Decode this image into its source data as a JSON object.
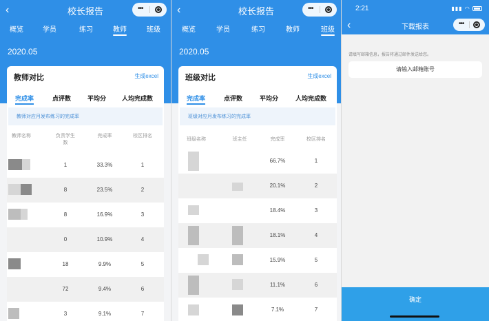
{
  "screens": [
    {
      "nav_title": "校长报告",
      "tabs": [
        "概览",
        "学员",
        "练习",
        "教师",
        "班级"
      ],
      "active_tab": 3,
      "date": "2020.05",
      "card_title": "教师对比",
      "export_label": "生成excel",
      "subtabs": [
        "完成率",
        "点评数",
        "平均分",
        "人均完成数"
      ],
      "note": "教师对应月发布练习的完成率",
      "columns": [
        "教师名称",
        "负责学生数",
        "完成率",
        "校区排名"
      ],
      "rows": [
        {
          "count": "1",
          "rate": "33.3%",
          "rank": "1"
        },
        {
          "count": "8",
          "rate": "23.5%",
          "rank": "2"
        },
        {
          "count": "8",
          "rate": "16.9%",
          "rank": "3"
        },
        {
          "count": "0",
          "rate": "10.9%",
          "rank": "4"
        },
        {
          "count": "18",
          "rate": "9.9%",
          "rank": "5"
        },
        {
          "count": "72",
          "rate": "9.4%",
          "rank": "6"
        },
        {
          "count": "3",
          "rate": "9.1%",
          "rank": "7"
        }
      ]
    },
    {
      "nav_title": "校长报告",
      "tabs": [
        "概览",
        "学员",
        "练习",
        "教师",
        "班级"
      ],
      "active_tab": 4,
      "date": "2020.05",
      "card_title": "班级对比",
      "export_label": "生成excel",
      "subtabs": [
        "完成率",
        "点评数",
        "平均分",
        "人均完成数"
      ],
      "note": "班级对应月发布练习的完成率",
      "columns": [
        "班级名称",
        "班主任",
        "完成率",
        "校区排名"
      ],
      "rows": [
        {
          "rate": "66.7%",
          "rank": "1"
        },
        {
          "rate": "20.1%",
          "rank": "2"
        },
        {
          "rate": "18.4%",
          "rank": "3"
        },
        {
          "rate": "18.1%",
          "rank": "4"
        },
        {
          "rate": "15.9%",
          "rank": "5"
        },
        {
          "rate": "11.1%",
          "rank": "6"
        },
        {
          "rate": "7.1%",
          "rank": "7"
        }
      ]
    },
    {
      "status_time": "2:21",
      "nav_title": "下载报表",
      "hint": "请填写邮箱信息，报告将通过邮件发送给您。",
      "email_placeholder": "请输入邮箱账号",
      "confirm_label": "确定"
    }
  ],
  "colors": {
    "primary": "#2f8fe7",
    "confirm": "#2fa0e8"
  }
}
